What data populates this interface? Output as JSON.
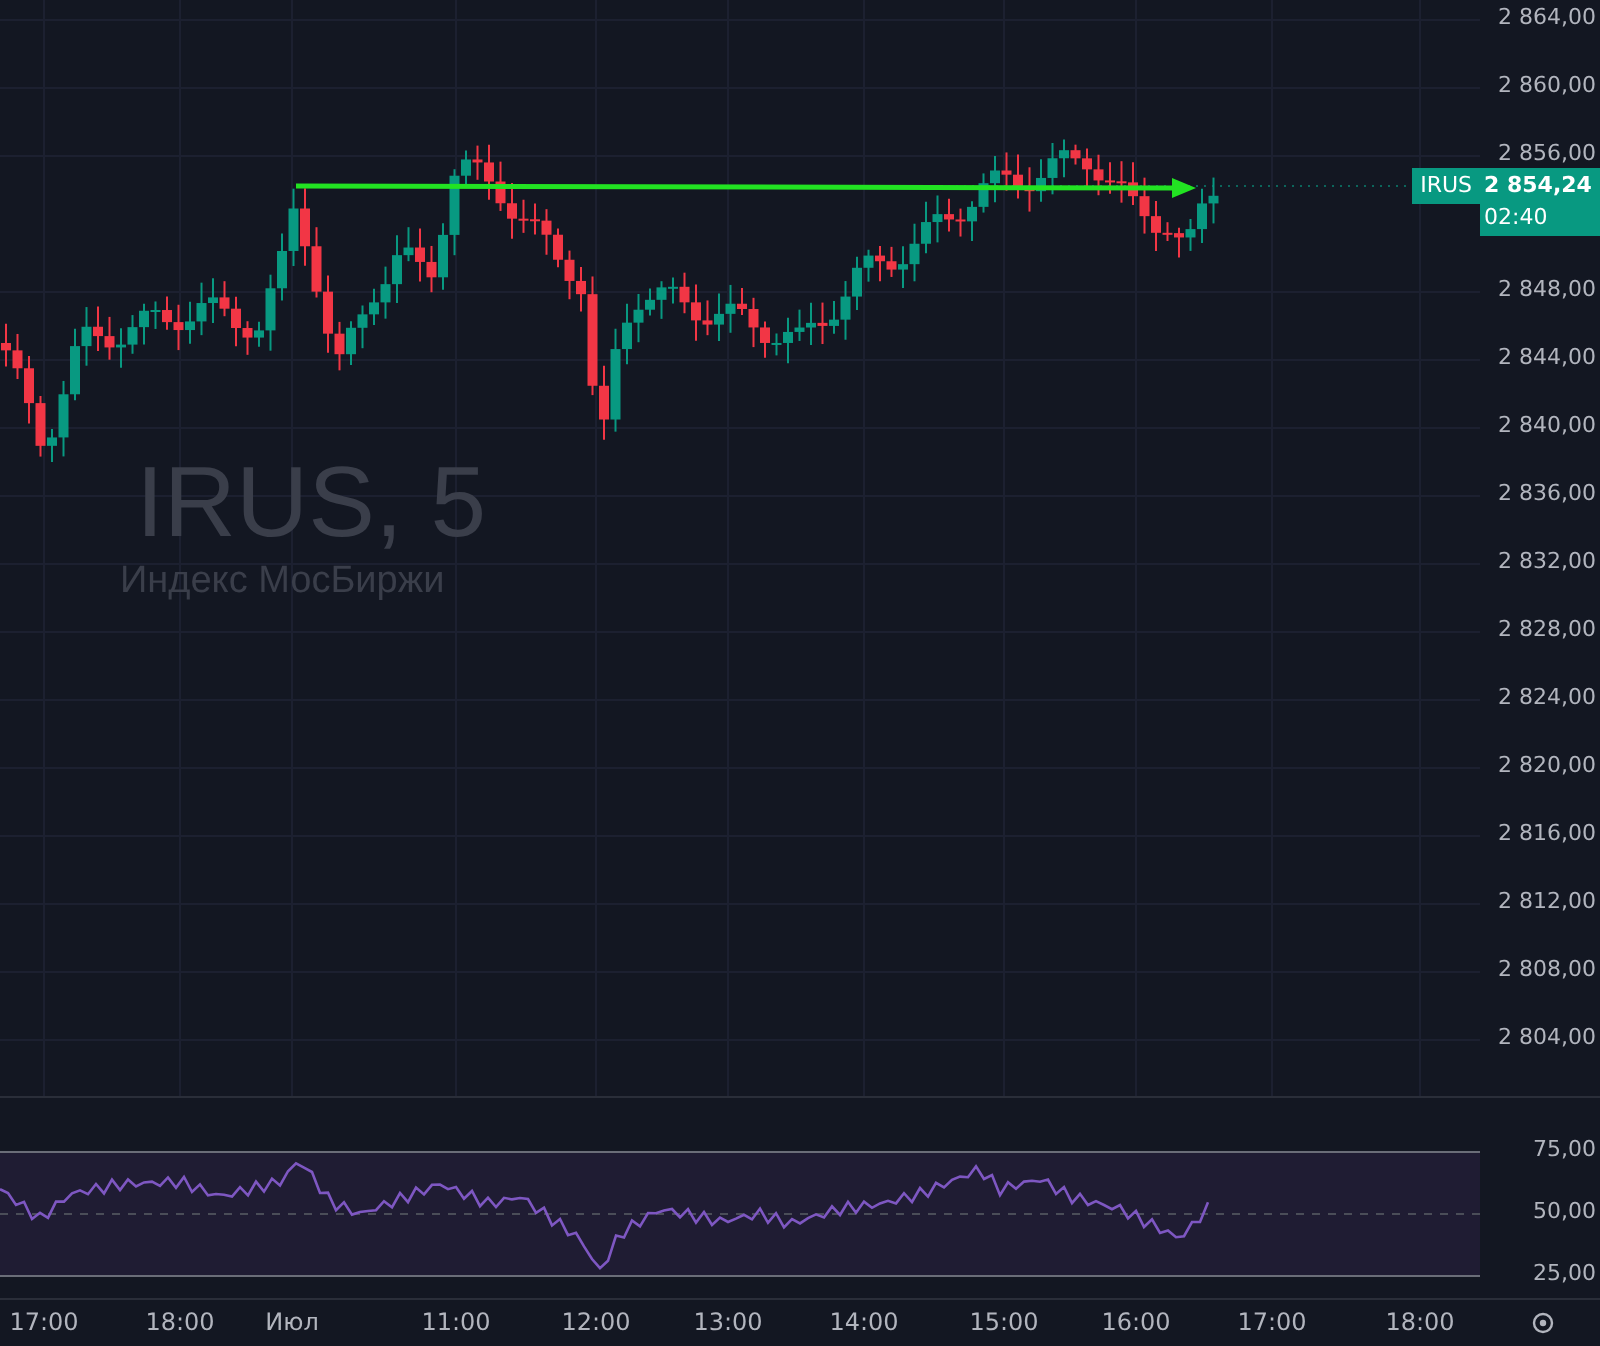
{
  "watermark": {
    "title": "IRUS, 5",
    "subtitle": "Индекс МосБиржи"
  },
  "price_axis": [
    "2 864,00",
    "2 860,00",
    "2 856,00",
    "2 848,00",
    "2 844,00",
    "2 840,00",
    "2 836,00",
    "2 832,00",
    "2 828,00",
    "2 824,00",
    "2 820,00",
    "2 816,00",
    "2 812,00",
    "2 808,00",
    "2 804,00"
  ],
  "last_price": {
    "symbol": "IRUS",
    "price": "2 854,24",
    "countdown": "02:40"
  },
  "rsi_axis": [
    "75,00",
    "50,00",
    "25,00"
  ],
  "time_axis": [
    "17:00",
    "18:00",
    "Июл",
    "11:00",
    "12:00",
    "13:00",
    "14:00",
    "15:00",
    "16:00",
    "17:00",
    "18:00"
  ]
}
